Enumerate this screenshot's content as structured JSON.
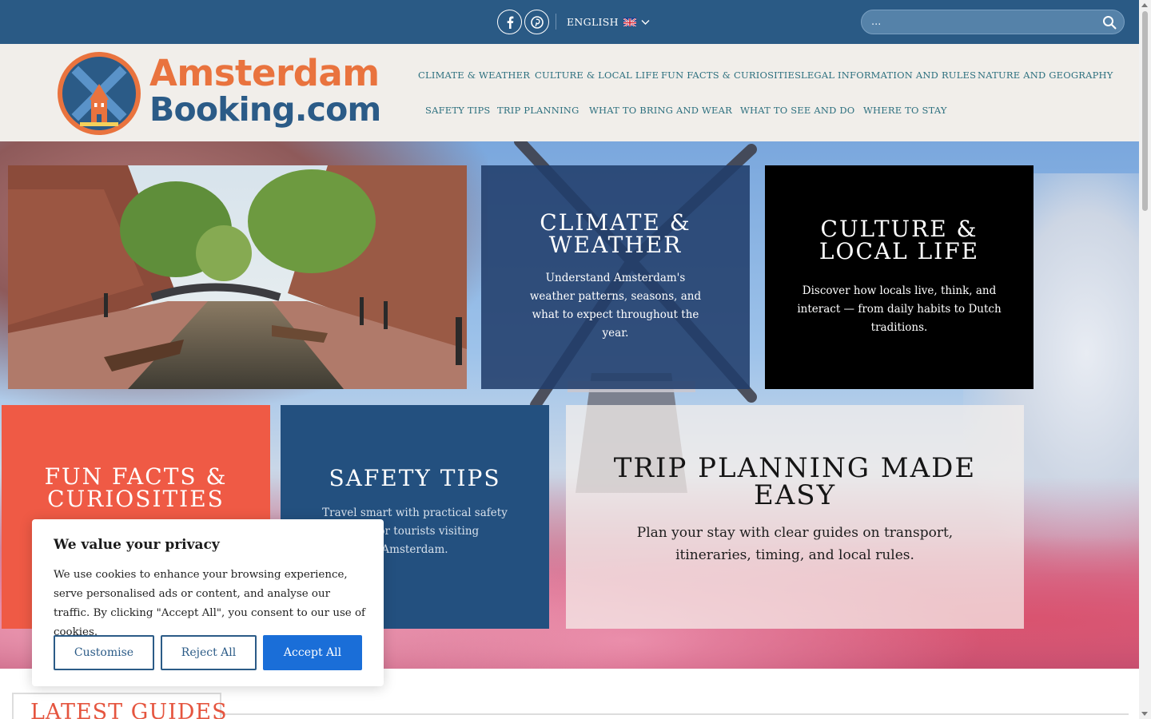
{
  "topbar": {
    "social": [
      {
        "name": "facebook-icon",
        "glyph": "f"
      },
      {
        "name": "pinterest-icon",
        "glyph": "p"
      }
    ],
    "language": {
      "label": "ENGLISH",
      "flag_icon": "uk-flag-icon",
      "chevron_icon": "chevron-down-icon"
    },
    "search": {
      "placeholder": "...",
      "icon": "search-icon"
    }
  },
  "header": {
    "logo": {
      "line1": "Amsterdam",
      "line2": "Booking.com",
      "icon": "windmill-logo-icon"
    },
    "nav": [
      "Climate & Weather",
      "Culture & Local Life",
      "Fun Facts & Curiosities",
      "Legal Information and Rules",
      "Nature and Geography",
      "Safety Tips",
      "Trip Planning",
      "What to Bring and Wear",
      "What to See and Do",
      "Where to Stay"
    ]
  },
  "hero": {
    "tiles": [
      {
        "title": "Climate &\nWeather",
        "text": "Understand Amsterdam's weather patterns, seasons, and what to expect throughout the year.",
        "bg": "#213d6b"
      },
      {
        "title": "Culture &\nLocal Life",
        "text": "Discover how locals live, think, and interact — from daily habits to Dutch traditions.",
        "bg": "#000000"
      },
      {
        "title": "Fun Facts &\nCuriosities",
        "text": "",
        "bg": "#ef5a45"
      },
      {
        "title": "Safety Tips",
        "text": "Travel smart with practical safety tips for tourists visiting Amsterdam.",
        "bg": "#23507f"
      },
      {
        "title": "Trip Planning Made\nEasy",
        "text": "Plan your stay with clear guides on transport, itineraries, timing, and local rules.",
        "bg": "#f3ece6"
      }
    ]
  },
  "cookie": {
    "title": "We value your privacy",
    "body": "We use cookies to enhance your browsing experience, serve personalised ads or content, and analyse our traffic. By clicking \"Accept All\", you consent to our use of cookies.",
    "customise": "Customise",
    "reject": "Reject All",
    "accept": "Accept All"
  },
  "latest": {
    "title": "Latest Guides"
  },
  "colors": {
    "topbar": "#2a5a85",
    "header_bg": "#f1eeea",
    "nav_text": "#2c6f7e",
    "accent_orange": "#e9733e",
    "accent_blue": "#2b5b87",
    "latest_red": "#e5553f",
    "accept_blue": "#1a6ed8"
  }
}
